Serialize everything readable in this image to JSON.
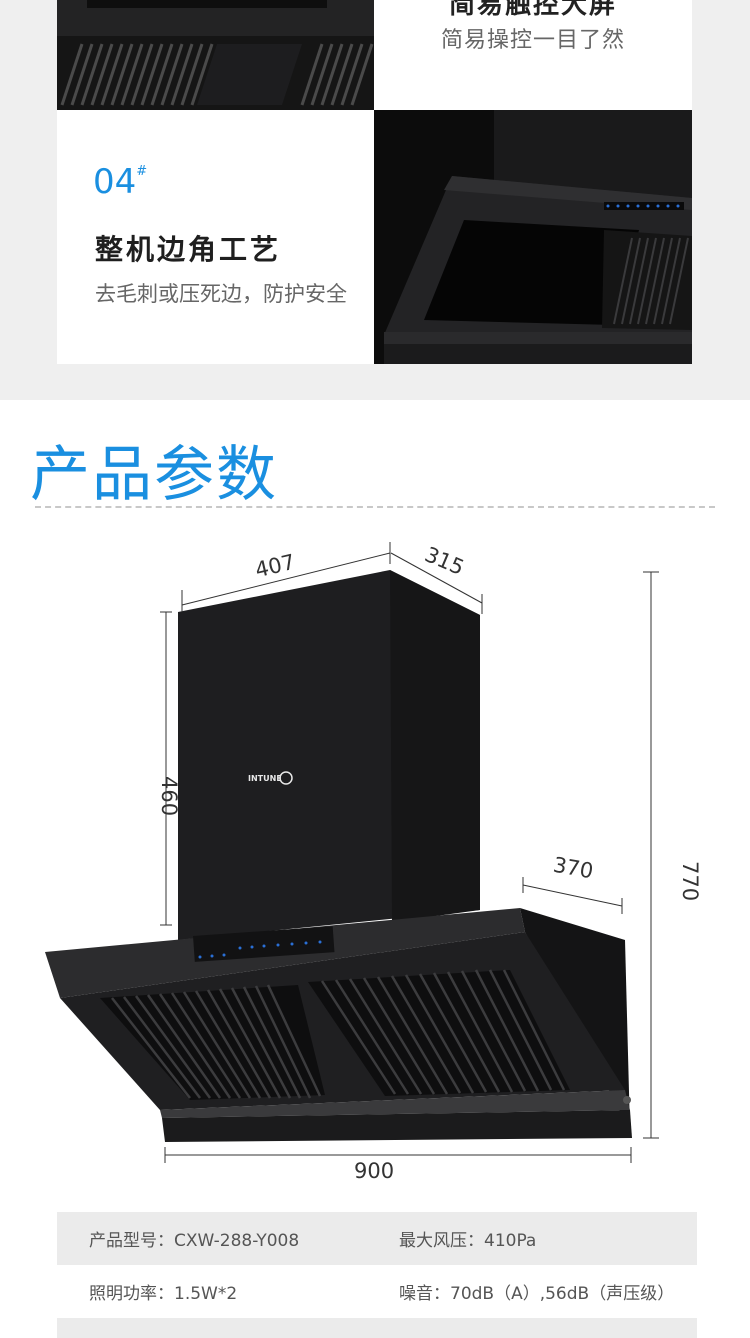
{
  "top_section": {
    "feature_03": {
      "title_partial": "简易触控大屏",
      "description": "简易操控一目了然"
    },
    "feature_04": {
      "number": "04",
      "number_mark": "#",
      "title": "整机边角工艺",
      "description": "去毛刺或压死边，防护安全"
    }
  },
  "params_section": {
    "title": "产品参数",
    "dimensions": {
      "width_top": "407",
      "depth_top": "315",
      "height_chimney": "460",
      "depth_hood": "370",
      "total_height": "770",
      "total_width": "900"
    },
    "brand_logo": "INTUNE",
    "specs": [
      {
        "left": "产品型号：CXW-288-Y008",
        "right": "最大风压：410Pa"
      },
      {
        "left": "照明功率：1.5W*2",
        "right": "噪音：70dB（A）,56dB（声压级）"
      }
    ]
  },
  "colors": {
    "accent": "#1a8fe0",
    "band_bg": "#efefef",
    "hood_black": "#1c1c1e"
  }
}
